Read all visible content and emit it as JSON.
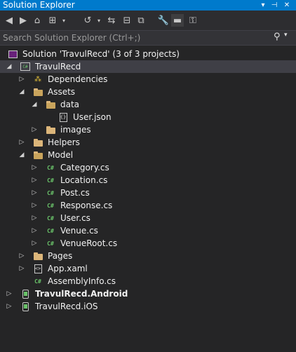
{
  "window": {
    "title": "Solution Explorer",
    "controls": [
      "dropdown-icon",
      "pin-icon",
      "close-icon"
    ]
  },
  "toolbar": {
    "buttons": [
      "back-icon",
      "forward-icon",
      "home-icon",
      "switch-views-icon",
      "history-icon",
      "sync-icon",
      "collapse-all-icon",
      "show-all-files-icon",
      "properties-icon",
      "preview-icon",
      "solution-filter-icon"
    ]
  },
  "search": {
    "placeholder": "Search Solution Explorer (Ctrl+;)"
  },
  "tree": {
    "solution": "Solution 'TravulRecd' (3 of 3 projects)",
    "items": [
      {
        "label": "TravulRecd"
      },
      {
        "label": "Dependencies"
      },
      {
        "label": "Assets"
      },
      {
        "label": "data"
      },
      {
        "label": "User.json"
      },
      {
        "label": "images"
      },
      {
        "label": "Helpers"
      },
      {
        "label": "Model"
      },
      {
        "label": "Category.cs"
      },
      {
        "label": "Location.cs"
      },
      {
        "label": "Post.cs"
      },
      {
        "label": "Response.cs"
      },
      {
        "label": "User.cs"
      },
      {
        "label": "Venue.cs"
      },
      {
        "label": "VenueRoot.cs"
      },
      {
        "label": "Pages"
      },
      {
        "label": "App.xaml"
      },
      {
        "label": "AssemblyInfo.cs"
      },
      {
        "label": "TravulRecd.Android"
      },
      {
        "label": "TravulRecd.iOS"
      }
    ]
  },
  "colors": {
    "titlebar": "#007acc",
    "background": "#252526",
    "selection": "#3f3f46",
    "csharp": "#6ac36a",
    "folder": "#dcb67a"
  }
}
